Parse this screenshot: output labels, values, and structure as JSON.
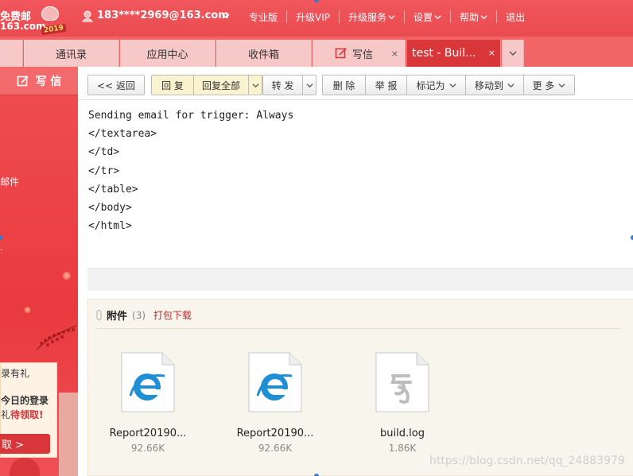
{
  "header": {
    "logo": {
      "line1": "免费邮",
      "line2": "163.com",
      "year": "2019"
    },
    "user_email": "183****2969@163.com",
    "nav": [
      {
        "label": "专业版",
        "dropdown": false
      },
      {
        "label": "升级VIP",
        "dropdown": false
      },
      {
        "label": "升级服务",
        "dropdown": true
      },
      {
        "label": "设置",
        "dropdown": true
      },
      {
        "label": "帮助",
        "dropdown": true
      },
      {
        "label": "退出",
        "dropdown": false
      }
    ]
  },
  "tabs": {
    "contacts": "通讯录",
    "apps": "应用中心",
    "inbox": "收件箱",
    "compose": "写信",
    "active": "test - Buil...",
    "close_glyph": "×"
  },
  "sidebar": {
    "compose_label": "写 信",
    "partial_item": "邮件",
    "partial_dot": "·",
    "promo": {
      "line1": "录有礼",
      "line2": "今日的登录",
      "line3_red": "礼",
      "line3_red2": "待领取!",
      "button": "取 >"
    }
  },
  "toolbar": {
    "back": "<< 返回",
    "reply": "回 复",
    "reply_all": "回复全部",
    "forward": "转 发",
    "delete": "删 除",
    "report": "举 报",
    "mark_as": "标记为",
    "move_to": "移动到",
    "more": "更 多"
  },
  "email_body": {
    "lines": [
      "Sending email for trigger: Always",
      "</textarea>",
      "</td>",
      "</tr>",
      "</table>",
      "</body>",
      "</html>"
    ]
  },
  "attachments": {
    "title": "附件",
    "count": "(3)",
    "download_all": "打包下载",
    "files": [
      {
        "name": "Report20190...",
        "size": "92.66K",
        "icon": "ie-icon"
      },
      {
        "name": "Report20190...",
        "size": "92.66K",
        "icon": "ie-icon"
      },
      {
        "name": "build.log",
        "size": "1.86K",
        "icon": "log-file-icon"
      }
    ]
  },
  "watermark": "https://blog.csdn.net/qq_24883979",
  "colors": {
    "brand_red": "#ea4b50",
    "active_tab": "#d9363a",
    "reply_highlight": "#fbf3cf",
    "ie_blue": "#1e8fd6"
  }
}
